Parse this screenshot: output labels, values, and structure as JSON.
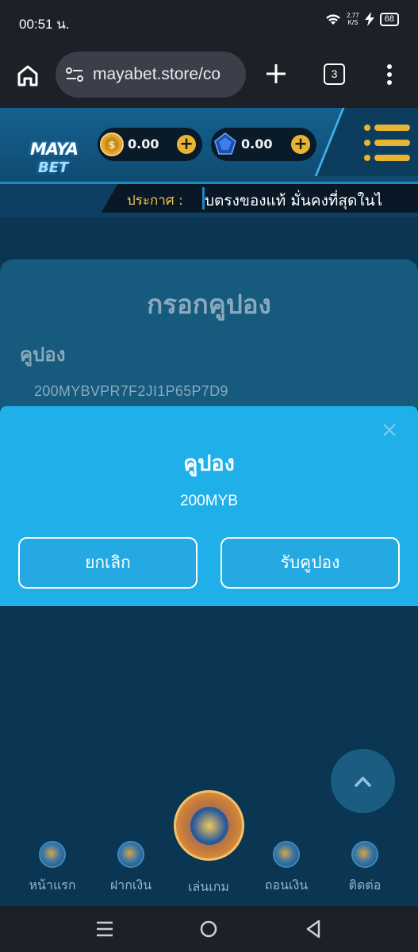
{
  "status_bar": {
    "time": "00:51 น.",
    "net_speed_value": "2.77",
    "net_speed_unit": "K/S",
    "battery": "68"
  },
  "browser": {
    "url": "mayabet.store/co",
    "tab_count": "3"
  },
  "header": {
    "logo_line1": "MAYA",
    "logo_line2": "BET",
    "coin_balance": "0.00",
    "gem_balance": "0.00",
    "announce_label": "ประกาศ :",
    "announce_text": "บตรงของแท้ มั่นคงที่สุดในไ"
  },
  "card": {
    "title": "กรอกคูปอง",
    "label": "คูปอง",
    "code": "200MYBVPR7F2JI1P65P7D9"
  },
  "modal": {
    "title": "คูปอง",
    "value": "200MYB",
    "cancel_label": "ยกเลิก",
    "accept_label": "รับคูปอง"
  },
  "bottom_nav": {
    "items": [
      {
        "label": "หน้าแรก"
      },
      {
        "label": "ฝากเงิน"
      },
      {
        "label": "เล่นเกม"
      },
      {
        "label": "ถอนเงิน"
      },
      {
        "label": "ติดต่อ"
      }
    ]
  },
  "colors": {
    "modal_bg": "#1fb0ea",
    "page_bg": "#0a3553",
    "accent_gold": "#e7b532",
    "announce_label": "#f0c14b"
  },
  "icons": [
    "home-icon",
    "site-settings-icon",
    "plus-icon",
    "tabs-icon",
    "more-vert-icon",
    "coin-icon",
    "gem-icon",
    "hamburger-icon",
    "close-icon",
    "chevron-up-icon",
    "recents-icon",
    "android-home-icon",
    "back-icon"
  ]
}
